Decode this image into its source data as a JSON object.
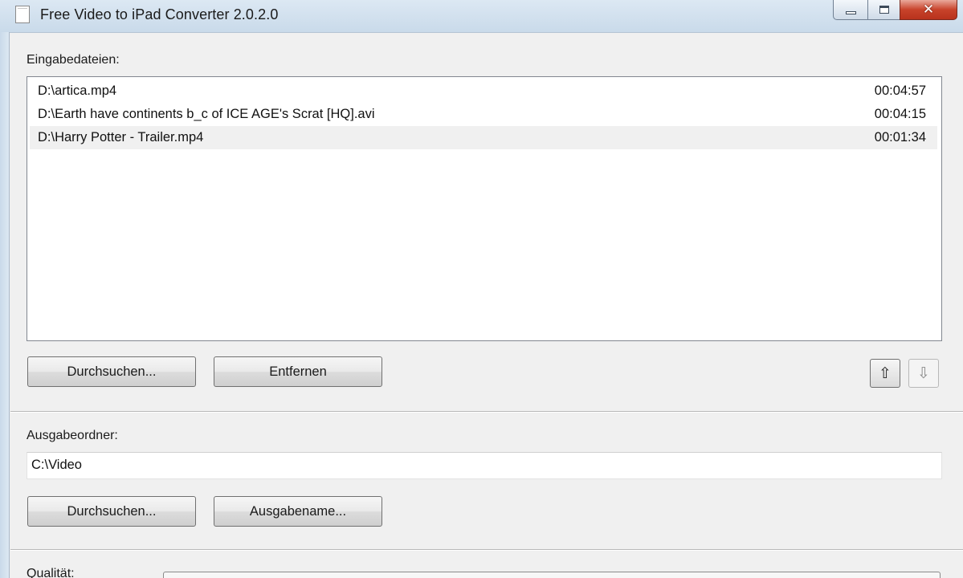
{
  "window": {
    "title": "Free Video to iPad Converter 2.0.2.0",
    "close_label": "✕"
  },
  "input_section": {
    "label": "Eingabedateien:",
    "files": [
      {
        "name": "D:\\artica.mp4",
        "duration": "00:04:57"
      },
      {
        "name": "D:\\Earth have continents b_c of ICE AGE's Scrat [HQ].avi",
        "duration": "00:04:15"
      },
      {
        "name": "D:\\Harry Potter - Trailer.mp4",
        "duration": "00:01:34"
      }
    ],
    "selected_index": 2,
    "browse_label": "Durchsuchen...",
    "remove_label": "Entfernen",
    "move_up_glyph": "⇧",
    "move_down_glyph": "⇩"
  },
  "output_section": {
    "label": "Ausgabeordner:",
    "folder_value": "C:\\Video",
    "browse_label": "Durchsuchen...",
    "output_name_label": "Ausgabename..."
  },
  "quality_section": {
    "label": "Qualität:"
  }
}
